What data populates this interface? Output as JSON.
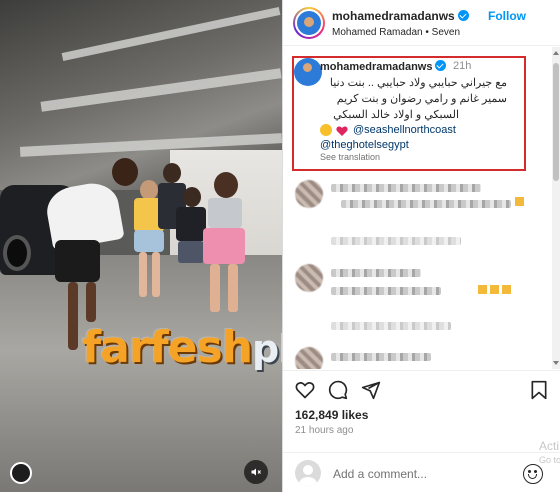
{
  "watermark": {
    "main": "farfesh",
    "suffix": "plus.com"
  },
  "post": {
    "username": "mohamedramadanws",
    "follow_label": "Follow",
    "subtitle": "Mohamed Ramadan • Seven"
  },
  "caption": {
    "username": "mohamedramadanws",
    "time": "21h",
    "lines": [
      "مع جيراني حبايبي ولاد حبايبي .. بنت دنيا",
      "سمير غانم و رامي رضوان و بنت كريم",
      "السبكي و اولاد خالد السبكي"
    ],
    "tag1": "@seashellnorthcoast",
    "tag2": "@theghotelsegypt",
    "see_translation": "See translation"
  },
  "stats": {
    "likes": "162,849 likes",
    "time_ago": "21 hours ago"
  },
  "comment_box": {
    "placeholder": "Add a comment..."
  },
  "os_overlay": {
    "title": "Acti",
    "sub": "Go to"
  },
  "icons": [
    "heart-icon",
    "comment-icon",
    "share-icon",
    "bookmark-icon",
    "emoji-icon",
    "mute-icon",
    "verified-icon"
  ],
  "colors": {
    "link": "#0095f6",
    "highlight": "#d42c2c",
    "watermark": "#f4a326"
  }
}
